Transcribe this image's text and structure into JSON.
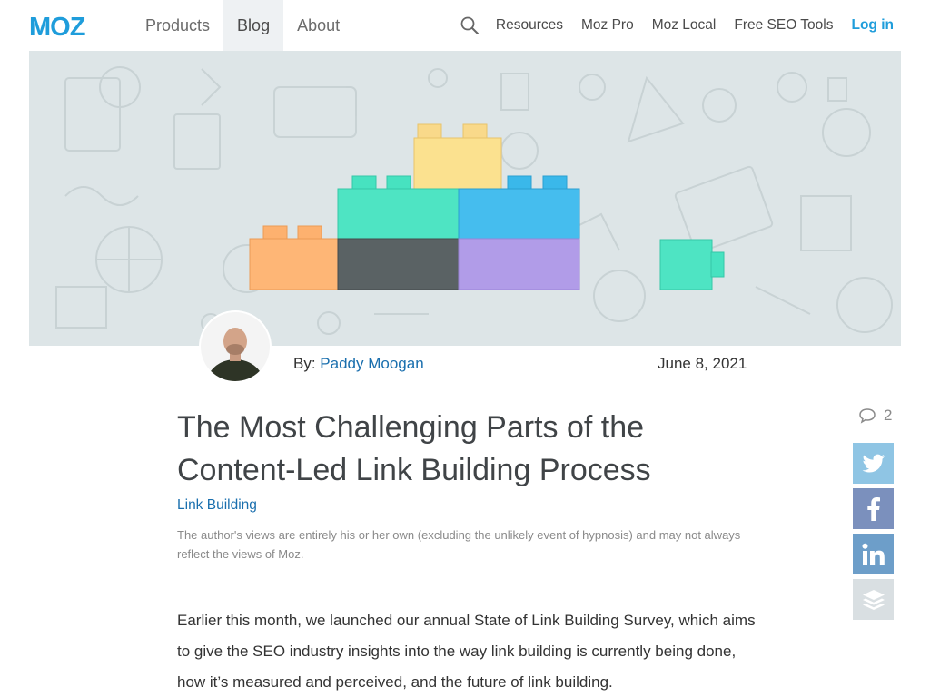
{
  "header": {
    "logo_text": "MOZ",
    "nav_left": [
      {
        "label": "Products",
        "active": false
      },
      {
        "label": "Blog",
        "active": true
      },
      {
        "label": "About",
        "active": false
      }
    ],
    "nav_right": [
      "Resources",
      "Moz Pro",
      "Moz Local",
      "Free SEO Tools"
    ],
    "login_label": "Log in"
  },
  "post": {
    "by_label": "By: ",
    "author": "Paddy Moogan",
    "date": "June 8, 2021",
    "title": "The Most Challenging Parts of the Content-Led Link Building Process",
    "category": "Link Building",
    "disclaimer": "The author's views are entirely his or her own (excluding the unlikely event of hypnosis) and may not always reflect the views of Moz.",
    "intro": "Earlier this month, we launched our annual State of Link Building Survey, which aims to give the SEO industry insights into the way link building is currently being done, how it’s measured and perceived, and the future of link building."
  },
  "share": {
    "comment_count": "2",
    "icons": [
      "twitter-icon",
      "facebook-icon",
      "linkedin-icon",
      "buffer-icon"
    ]
  },
  "colors": {
    "brand": "#1f9ddb",
    "link": "#1a6fae",
    "hero_bg": "#dde5e7"
  }
}
